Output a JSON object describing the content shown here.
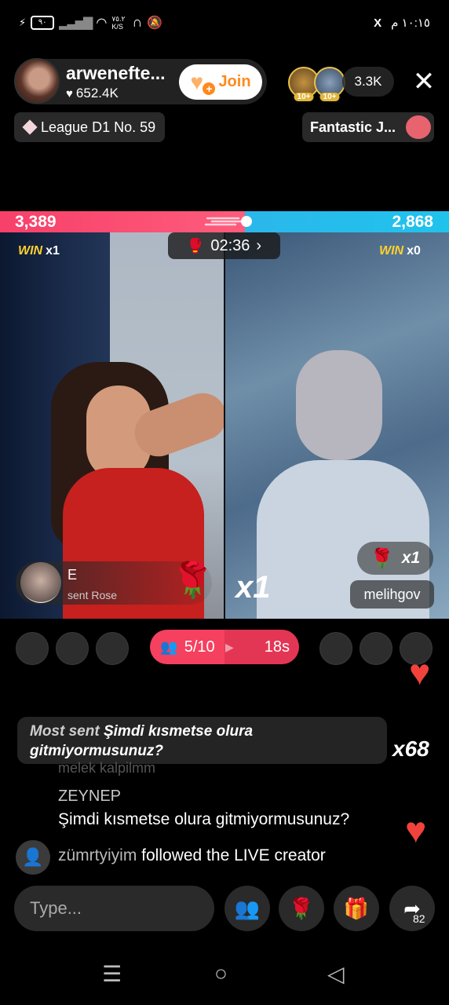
{
  "status_bar": {
    "time": "١٠:١٥ م",
    "speed": "٧٥.٢\nK/S",
    "battery": "٩٠",
    "x_app": "X"
  },
  "host": {
    "name": "arwenefte...",
    "likes": "652.4K",
    "join_label": "Join"
  },
  "viewers": {
    "badge_1": "10+",
    "badge_2": "10+",
    "count": "3.3K"
  },
  "league": {
    "label": "League D1 No. 59"
  },
  "rank_tag": {
    "label": "Fantastic J..."
  },
  "battle": {
    "score_left": "3,389",
    "score_right": "2,868",
    "timer": "02:36",
    "win_label": "WIN",
    "left_wins": "x1",
    "right_wins": "x0"
  },
  "gift_toast": {
    "sender": "E",
    "action": "sent Rose",
    "combo": "x1"
  },
  "opponent": {
    "rose_count": "x1",
    "name": "melihgov"
  },
  "team": {
    "members": "5/10",
    "countdown": "18s"
  },
  "chat": {
    "most_sent_label": "Most sent",
    "most_sent_text": "Şimdi kısmetse olura gitmiyormusunuz?",
    "most_sent_count": "x68",
    "faded_line": "melek kalpilmm",
    "messages": [
      {
        "user": "ZEYNEP",
        "text": "Şimdi kısmetse olura gitmiyormusunuz?"
      }
    ],
    "follow": {
      "user": "zümrtyiyim",
      "text": "followed the LIVE creator"
    }
  },
  "composer": {
    "placeholder": "Type...",
    "share_count": "82"
  },
  "colors": {
    "score_left": "#f7406a",
    "score_right": "#20c3ec",
    "join": "#fe8a1e",
    "win": "#ffd02f"
  },
  "icons": [
    "lightning-icon",
    "battery-icon",
    "signal-icon",
    "wifi-icon",
    "headphones-icon",
    "mute-icon",
    "x-app-icon",
    "heart-icon",
    "close-icon",
    "diamond-icon",
    "pig-icon",
    "gloves-icon",
    "chevron-right-icon",
    "rose-icon",
    "people-icon",
    "follow-icon",
    "team-icon",
    "gift-icon",
    "share-icon",
    "menu-nav-icon",
    "home-nav-icon",
    "back-nav-icon"
  ]
}
